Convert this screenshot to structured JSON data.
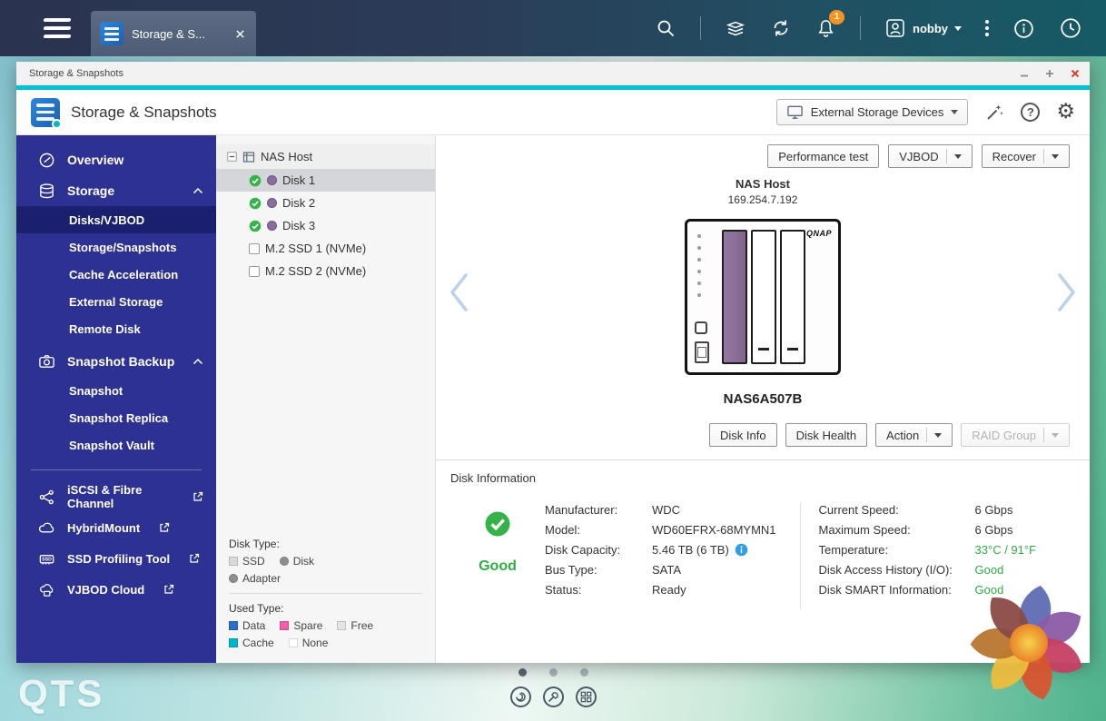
{
  "colors": {
    "accent_teal": "#00c1d4",
    "sidebar_bg": "#2d3192",
    "sidebar_selected": "#1a1f6e",
    "good_green": "#2fae47",
    "badge_orange": "#f7941d",
    "disk_bay_purple": "#8d6d9f"
  },
  "taskbar": {
    "tab_label": "Storage & S...",
    "user_name": "nobby",
    "notification_count": "1"
  },
  "window": {
    "titlebar_title": "Storage & Snapshots",
    "header_title": "Storage & Snapshots",
    "device_selector": "External Storage Devices"
  },
  "sidebar": {
    "items": [
      {
        "label": "Overview"
      },
      {
        "label": "Storage"
      },
      {
        "label": "Disks/VJBOD",
        "selected": true
      },
      {
        "label": "Storage/Snapshots"
      },
      {
        "label": "Cache Acceleration"
      },
      {
        "label": "External Storage"
      },
      {
        "label": "Remote Disk"
      },
      {
        "label": "Snapshot Backup"
      },
      {
        "label": "Snapshot"
      },
      {
        "label": "Snapshot Replica"
      },
      {
        "label": "Snapshot Vault"
      },
      {
        "label": "iSCSI & Fibre Channel",
        "external": true
      },
      {
        "label": "HybridMount",
        "external": true
      },
      {
        "label": "SSD Profiling Tool",
        "external": true
      },
      {
        "label": "VJBOD Cloud",
        "external": true
      }
    ]
  },
  "tree": {
    "root_label": "NAS Host",
    "items": [
      {
        "label": "Disk 1",
        "status": "good",
        "selected": true
      },
      {
        "label": "Disk 2",
        "status": "good"
      },
      {
        "label": "Disk 3",
        "status": "good"
      },
      {
        "label": "M.2 SSD 1 (NVMe)",
        "checkbox": true
      },
      {
        "label": "M.2 SSD 2 (NVMe)",
        "checkbox": true
      }
    ],
    "legend": {
      "disk_type_title": "Disk Type:",
      "disk_types": [
        {
          "label": "SSD",
          "color": "#dadada"
        },
        {
          "label": "Disk",
          "color": "#8f8f8f"
        },
        {
          "label": "Adapter",
          "color": "#8f8f8f"
        }
      ],
      "used_type_title": "Used Type:",
      "used_types": [
        {
          "label": "Data",
          "color": "#2a6fc9"
        },
        {
          "label": "Spare",
          "color": "#ee5fa7"
        },
        {
          "label": "Free",
          "color": "#e4e4e4"
        },
        {
          "label": "Cache",
          "color": "#00b7c9"
        },
        {
          "label": "None",
          "color": "#ffffff"
        }
      ]
    }
  },
  "main": {
    "toolbar": [
      {
        "label": "Performance test",
        "dropdown": false
      },
      {
        "label": "VJBOD",
        "dropdown": true
      },
      {
        "label": "Recover",
        "dropdown": true
      }
    ],
    "device": {
      "name": "NAS Host",
      "ip": "169.254.7.192",
      "model": "NAS6A507B",
      "brand": "QNAP"
    },
    "actions": [
      {
        "label": "Disk Info"
      },
      {
        "label": "Disk Health"
      },
      {
        "label": "Action",
        "dropdown": true
      },
      {
        "label": "RAID Group",
        "dropdown": true,
        "disabled": true
      }
    ],
    "disk_info": {
      "section_title": "Disk Information",
      "health_label": "Good",
      "fields_left": [
        {
          "label": "Manufacturer:",
          "value": "WDC"
        },
        {
          "label": "Model:",
          "value": "WD60EFRX-68MYMN1"
        },
        {
          "label": "Disk Capacity:",
          "value": "5.46 TB (6 TB)",
          "info_icon": true
        },
        {
          "label": "Bus Type:",
          "value": "SATA"
        },
        {
          "label": "Status:",
          "value": "Ready"
        }
      ],
      "fields_right": [
        {
          "label": "Current Speed:",
          "value": "6 Gbps"
        },
        {
          "label": "Maximum Speed:",
          "value": "6 Gbps"
        },
        {
          "label": "Temperature:",
          "value": "33°C / 91°F",
          "color": "green"
        },
        {
          "label": "Disk Access History (I/O):",
          "value": "Good",
          "color": "green"
        },
        {
          "label": "Disk SMART Information:",
          "value": "Good",
          "color": "green"
        }
      ]
    }
  },
  "desktop": {
    "logo_text": "QTS"
  },
  "icons": {
    "help_glyph": "?",
    "gear_glyph": "⚙",
    "ssd_label": "SSD"
  }
}
